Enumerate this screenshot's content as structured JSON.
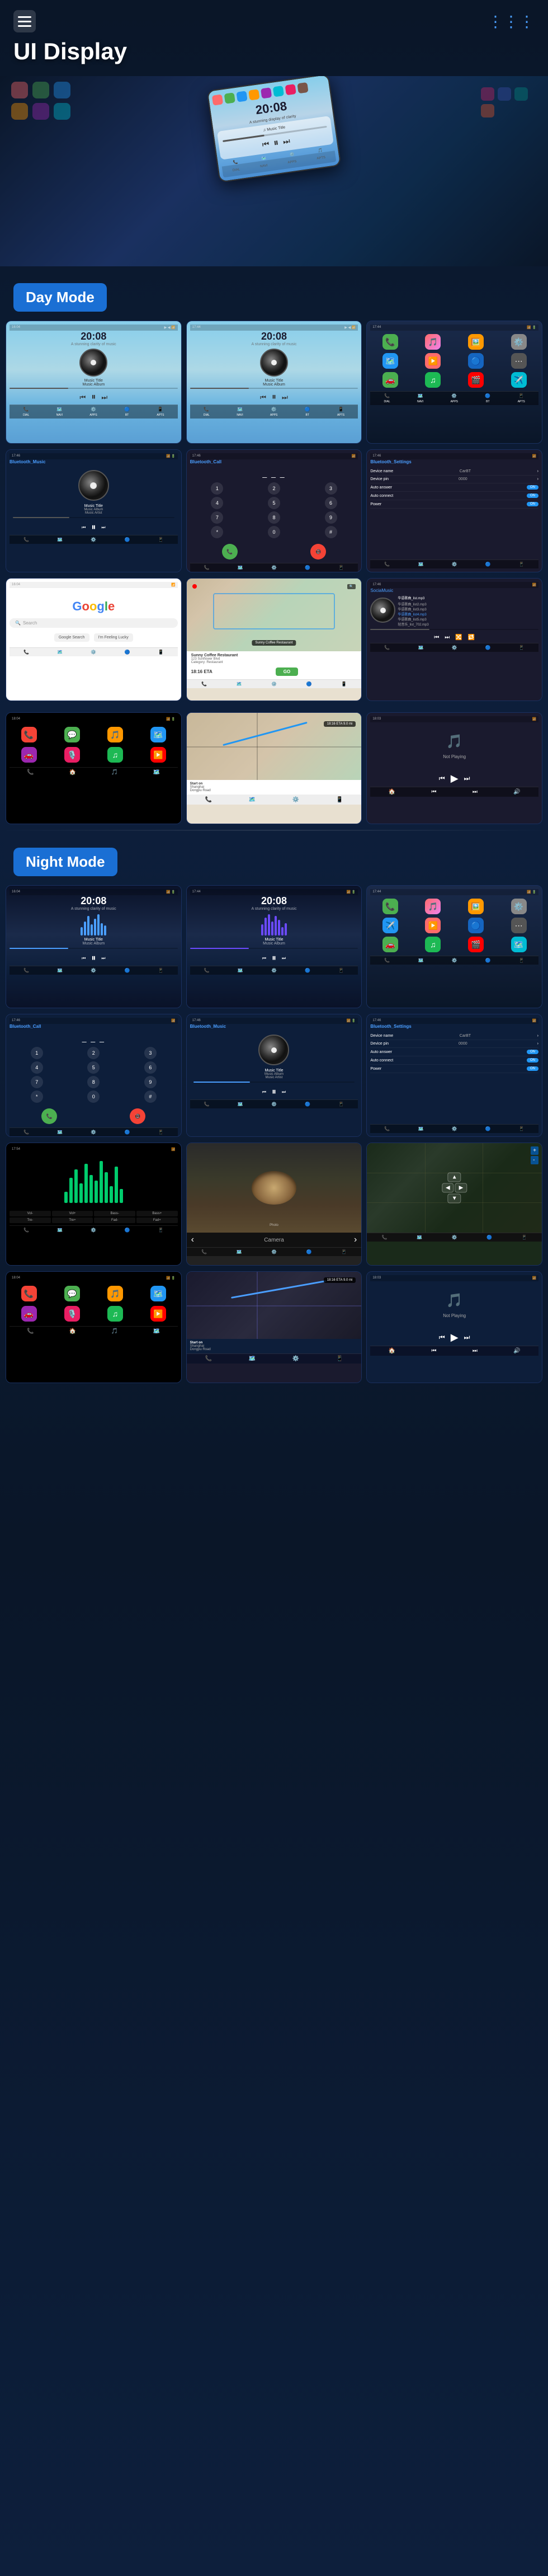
{
  "header": {
    "title": "UI Display",
    "menu_icon": "≡",
    "nav_dots": "⋮"
  },
  "hero": {
    "time": "20:08",
    "subtitle": "A stunning display of clarity"
  },
  "day_mode": {
    "label": "Day Mode",
    "screens": [
      {
        "type": "music",
        "time": "20:08",
        "subtitle": "A stunning clarity of music"
      },
      {
        "type": "music2",
        "time": "20:08",
        "subtitle": "A stunning clarity of music"
      },
      {
        "type": "appgrid",
        "label": "App Grid"
      },
      {
        "type": "music_player",
        "title": "Bluetooth_Music",
        "track": "Music Title",
        "artist": "Music Album\nMusic Artist"
      },
      {
        "type": "dialer",
        "title": "Bluetooth_Call"
      },
      {
        "type": "settings",
        "title": "Bluetooth_Settings",
        "items": [
          {
            "label": "Device name",
            "value": "CarBT"
          },
          {
            "label": "Device pin",
            "value": "0000"
          },
          {
            "label": "Auto answer",
            "value": "on"
          },
          {
            "label": "Auto connect",
            "value": "on"
          },
          {
            "label": "Power",
            "value": "on"
          }
        ]
      },
      {
        "type": "google",
        "label": "Google"
      },
      {
        "type": "map_nav",
        "label": "Navigation Map"
      },
      {
        "type": "social_music",
        "label": "SociaMusic"
      }
    ]
  },
  "night_mode": {
    "label": "Night Mode",
    "screens": [
      {
        "type": "music_night",
        "time": "20:08"
      },
      {
        "type": "music_night2",
        "time": "20:08"
      },
      {
        "type": "appgrid_night",
        "label": "App Grid Night"
      },
      {
        "type": "dialer_night",
        "title": "Bluetooth_Call"
      },
      {
        "type": "music_player_night",
        "title": "Bluetooth_Music",
        "track": "Music Title",
        "artist": "Music Album\nMusic Artist"
      },
      {
        "type": "settings_night",
        "title": "Bluetooth_Settings"
      },
      {
        "type": "green_music",
        "label": "Green EQ"
      },
      {
        "type": "food_photo",
        "label": "Food Photo"
      },
      {
        "type": "map_dark",
        "label": "Map Dark"
      },
      {
        "type": "carplay_apps",
        "label": "CarPlay Apps"
      },
      {
        "type": "carplay_music",
        "label": "CarPlay Music"
      },
      {
        "type": "carplay_nav",
        "label": "CarPlay Nav"
      }
    ]
  },
  "common": {
    "nav_items": [
      "DIAL",
      "NAVI",
      "APPS",
      "BT",
      "APTS"
    ],
    "time_display": "20:08"
  }
}
